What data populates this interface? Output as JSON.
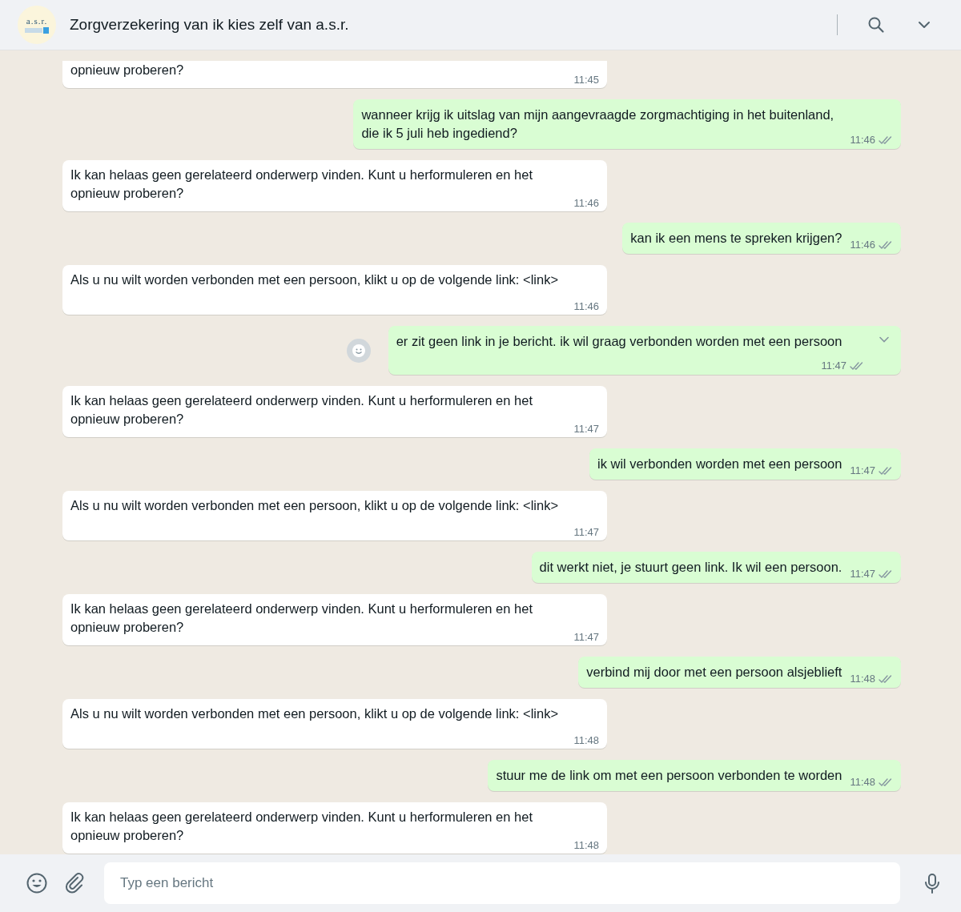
{
  "header": {
    "avatar_logo": "a.s.r.",
    "title": "Zorgverzekering van ik kies zelf van a.s.r."
  },
  "messages": [
    {
      "kind": "incoming",
      "text": "opnieuw proberen?",
      "time": "11:45",
      "cut": true,
      "hovered": false
    },
    {
      "kind": "outgoing",
      "text": "wanneer krijg ik uitslag van mijn aangevraagde zorgmachtiging in het buitenland, die ik 5 juli heb ingediend?",
      "time": "11:46",
      "read": false,
      "cut": false,
      "hovered": false
    },
    {
      "kind": "incoming",
      "text": "Ik kan helaas geen gerelateerd onderwerp vinden. Kunt u herformuleren en het opnieuw proberen?",
      "time": "11:46",
      "cut": false,
      "hovered": false
    },
    {
      "kind": "outgoing",
      "text": "kan ik een mens te spreken krijgen?",
      "time": "11:46",
      "read": false,
      "cut": false,
      "hovered": false
    },
    {
      "kind": "incoming",
      "text": "Als u nu wilt worden verbonden met een persoon, klikt u op de volgende link: <link>",
      "time": "11:46",
      "cut": false,
      "hovered": false
    },
    {
      "kind": "outgoing",
      "text": "er zit geen link in je bericht. ik wil graag verbonden worden met een persoon",
      "time": "11:47",
      "read": false,
      "cut": false,
      "hovered": true
    },
    {
      "kind": "incoming",
      "text": "Ik kan helaas geen gerelateerd onderwerp vinden. Kunt u herformuleren en het opnieuw proberen?",
      "time": "11:47",
      "cut": false,
      "hovered": false
    },
    {
      "kind": "outgoing",
      "text": "ik wil verbonden worden met een persoon",
      "time": "11:47",
      "read": false,
      "cut": false,
      "hovered": false
    },
    {
      "kind": "incoming",
      "text": "Als u nu wilt worden verbonden met een persoon, klikt u op de volgende link: <link>",
      "time": "11:47",
      "cut": false,
      "hovered": false
    },
    {
      "kind": "outgoing",
      "text": "dit werkt niet, je stuurt geen link. Ik wil een persoon.",
      "time": "11:47",
      "read": false,
      "cut": false,
      "hovered": false
    },
    {
      "kind": "incoming",
      "text": "Ik kan helaas geen gerelateerd onderwerp vinden. Kunt u herformuleren en het opnieuw proberen?",
      "time": "11:47",
      "cut": false,
      "hovered": false
    },
    {
      "kind": "outgoing",
      "text": "verbind mij door met een persoon alsjeblieft",
      "time": "11:48",
      "read": false,
      "cut": false,
      "hovered": false
    },
    {
      "kind": "incoming",
      "text": "Als u nu wilt worden verbonden met een persoon, klikt u op de volgende link: <link>",
      "time": "11:48",
      "cut": false,
      "hovered": false
    },
    {
      "kind": "outgoing",
      "text": "stuur me de link om met een persoon verbonden te worden",
      "time": "11:48",
      "read": false,
      "cut": false,
      "hovered": false
    },
    {
      "kind": "incoming",
      "text": "Ik kan helaas geen gerelateerd onderwerp vinden. Kunt u herformuleren en het opnieuw proberen?",
      "time": "11:48",
      "cut": false,
      "hovered": false
    }
  ],
  "composer": {
    "placeholder": "Typ een bericht"
  }
}
